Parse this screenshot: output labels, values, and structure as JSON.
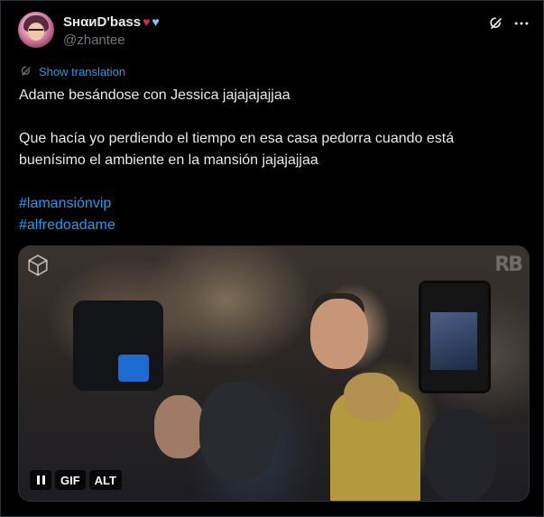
{
  "user": {
    "display_name": "SнαиD'bass",
    "heart_1": "♥",
    "heart_2": "♥",
    "handle": "@zhantee"
  },
  "icons": {
    "grok": "grok-icon",
    "more": "more-icon",
    "translate": "translate-icon",
    "media_logo": "cube-logo-icon",
    "pause": "pause-icon"
  },
  "translate": {
    "label": "Show translation"
  },
  "tweet": {
    "line1": "Adame besándose con Jessica jajajajajjaa",
    "line2": "Que hacía yo perdiendo el tiempo en esa casa pedorra cuando está buenísimo el ambiente en la mansión jajajajjaa",
    "hashtags": [
      "#lamansiónvip",
      "#alfredoadame"
    ]
  },
  "media": {
    "watermark": "RB",
    "controls": {
      "gif": "GIF",
      "alt": "ALT"
    }
  },
  "colors": {
    "background": "#000000",
    "text": "#e7e9ea",
    "muted": "#71767b",
    "accent": "#1d9bf0",
    "heart_red": "#e0245e",
    "heart_blue": "#7cc4f2"
  }
}
